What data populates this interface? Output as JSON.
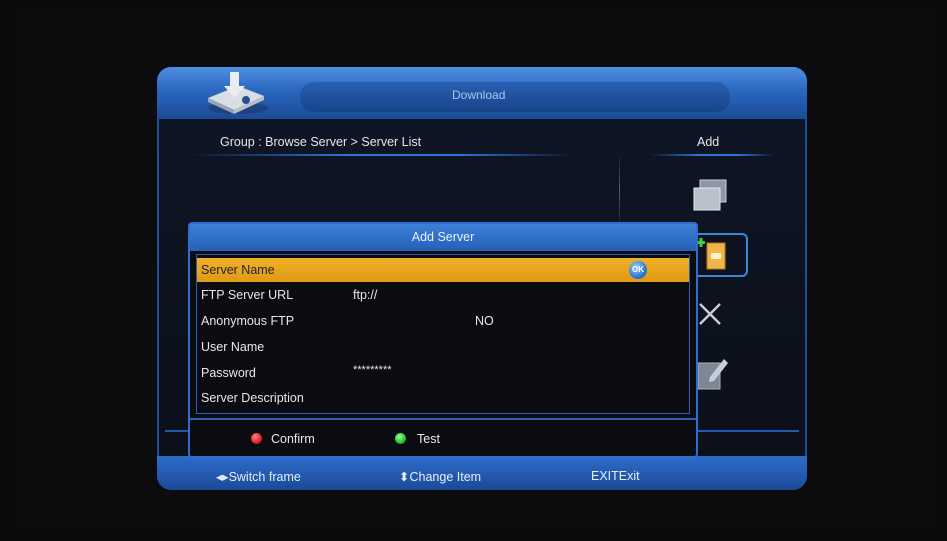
{
  "window": {
    "title": "Download"
  },
  "breadcrumb": "Group : Browse Server > Server List",
  "side_panel": {
    "header": "Add",
    "icons": [
      "servers-icon",
      "add-server-icon",
      "delete-icon",
      "edit-icon"
    ]
  },
  "dialog": {
    "title": "Add Server",
    "fields": [
      {
        "label": "Server Name",
        "value": "",
        "selected": true
      },
      {
        "label": "FTP Server URL",
        "value": "ftp://"
      },
      {
        "label": "Anonymous FTP",
        "value": "NO"
      },
      {
        "label": "User Name",
        "value": ""
      },
      {
        "label": "Password",
        "value": "*********"
      },
      {
        "label": "Server Description",
        "value": ""
      }
    ],
    "ok_badge": "OK",
    "buttons": {
      "confirm": "Confirm",
      "test": "Test"
    }
  },
  "footer": {
    "switch_frame": "Switch frame",
    "change_item": "Change Item",
    "exit_key": "EXIT",
    "exit_label": "Exit"
  },
  "colors": {
    "accent_blue": "#2d6ecf",
    "highlight": "#f0b028",
    "confirm": "#e02020",
    "test": "#22c422"
  }
}
